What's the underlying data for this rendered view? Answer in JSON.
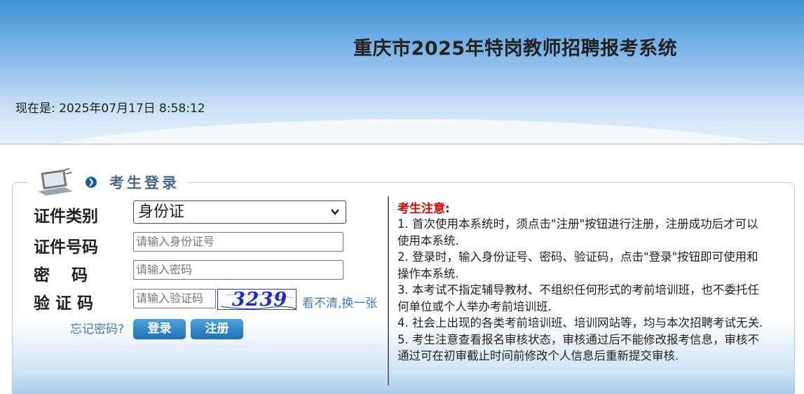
{
  "header": {
    "title": "重庆市2025年特岗教师招聘报考系统",
    "clock": "现在是: 2025年07月17日 8:58:12"
  },
  "login": {
    "section_title": "考生登录",
    "labels": {
      "id_type": "证件类别",
      "id_number": "证件号码",
      "password": "密　码",
      "captcha": "验 证 码"
    },
    "id_type_selected": "身份证",
    "placeholders": {
      "id_number": "请输入身份证号",
      "password": "请输入密码",
      "captcha": "请输入验证码"
    },
    "captcha_image_text": "3239",
    "refresh_link": "看不清,换一张",
    "forgot_link": "忘记密码?",
    "login_button": "登录",
    "register_button": "注册"
  },
  "notice": {
    "title": "考生注意:",
    "items": [
      "1. 首次使用本系统时，须点击\"注册\"按钮进行注册，注册成功后才可以使用本系统.",
      "2. 登录时，输入身份证号、密码、验证码，点击\"登录\"按钮即可使用和操作本系统.",
      "3. 本考试不指定辅导教材、不组织任何形式的考前培训班，也不委托任何单位或个人举办考前培训班.",
      "4. 社会上出现的各类考前培训班、培训网站等，均与本次招聘考试无关.",
      "5. 考生注意查看报名审核状态，审核通过后不能修改报考信息，审核不通过可在初审截止时间前修改个人信息后重新提交审核."
    ]
  },
  "colors": {
    "header_top": "#3d92d6",
    "notice_title": "#e00000",
    "link": "#3f7cc0",
    "button": "#1c6fb3",
    "captcha": "#1b2dcf"
  },
  "icons": {
    "section": "laptop-icon",
    "section_arrow": "arrow-circle-icon",
    "select": "chevron-down-icon"
  }
}
